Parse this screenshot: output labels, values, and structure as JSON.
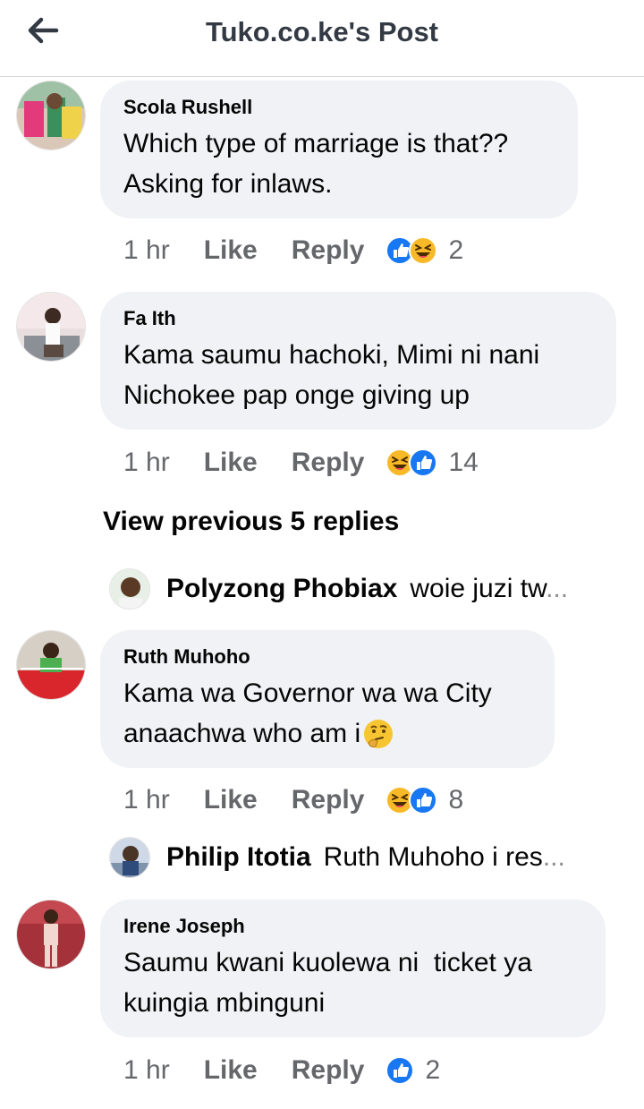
{
  "header": {
    "title": "Tuko.co.ke's Post",
    "back_icon": "arrow-left-icon"
  },
  "colors": {
    "bubble": "#f0f2f5",
    "secondary_text": "#65676b",
    "like_blue": "#1877f2",
    "haha_yellow": "#f7b928"
  },
  "comments": [
    {
      "author": "Scola Rushell",
      "lines": [
        "Which type of marriage is that??",
        "Asking for inlaws."
      ],
      "time": "1 hr",
      "like": "Like",
      "reply": "Reply",
      "reactions": [
        "like",
        "haha"
      ],
      "count": "2"
    },
    {
      "author": "Fa Ith",
      "lines": [
        "Kama saumu hachoki, Mimi ni nani",
        "Nichokee pap onge giving up"
      ],
      "time": "1 hr",
      "like": "Like",
      "reply": "Reply",
      "reactions": [
        "haha",
        "like"
      ],
      "count": "14"
    },
    {
      "author": "Ruth Muhoho",
      "lines": [
        "Kama wa Governor wa wa City",
        "anaachwa who am i"
      ],
      "emoji": "thinking-face",
      "time": "1 hr",
      "like": "Like",
      "reply": "Reply",
      "reactions": [
        "haha",
        "like"
      ],
      "count": "8"
    },
    {
      "author": "Irene Joseph",
      "lines": [
        "Saumu kwani kuolewa ni  ticket ya",
        "kuingia mbinguni"
      ],
      "time": "1 hr",
      "like": "Like",
      "reply": "Reply",
      "reactions": [
        "like"
      ],
      "count": "2"
    }
  ],
  "view_previous": "View previous 5 replies",
  "replies": [
    {
      "author": "Polyzong Phobiax",
      "snippet": "woie juzi tw",
      "ellipsis": "..."
    },
    {
      "author": "Philip Itotia",
      "snippet": "Ruth Muhoho i res",
      "ellipsis": "..."
    }
  ]
}
